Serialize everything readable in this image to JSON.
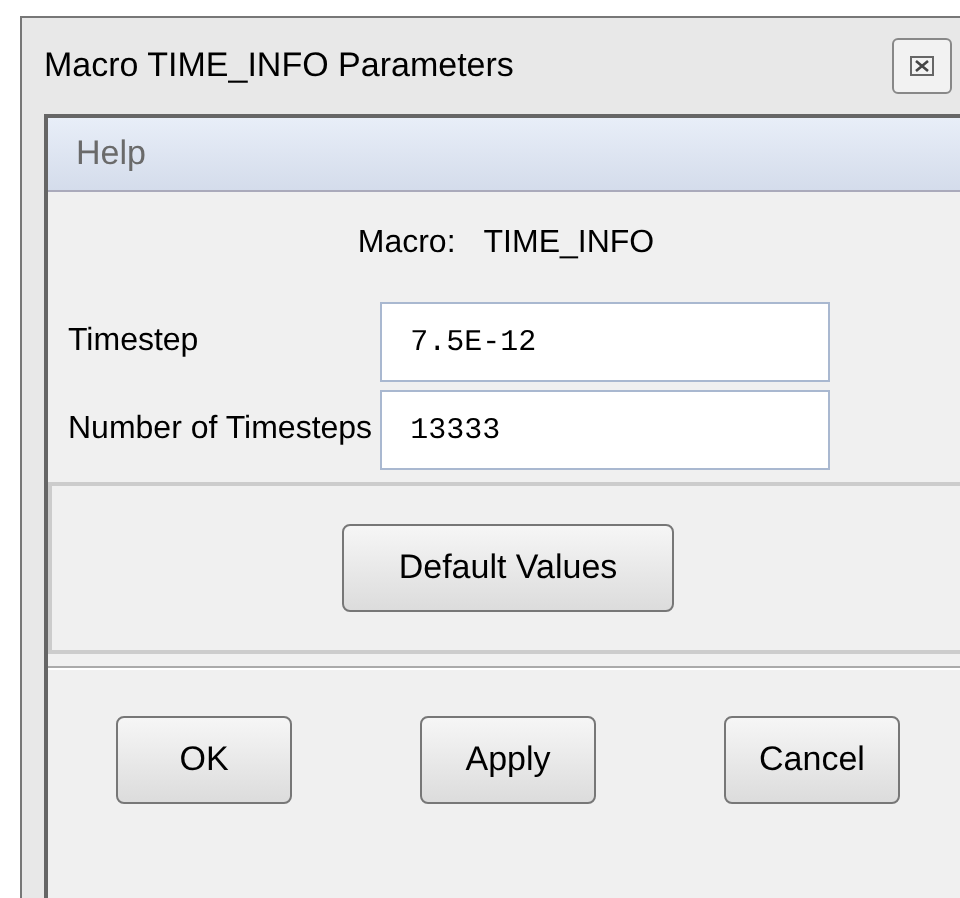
{
  "window": {
    "title": "Macro TIME_INFO Parameters"
  },
  "menu": [
    {
      "label": "Help"
    }
  ],
  "macro": {
    "label": "Macro:",
    "value": "TIME_INFO"
  },
  "fields": [
    {
      "label": "Timestep",
      "value": "7.5E-12"
    },
    {
      "label": "Number of Timesteps",
      "value": "13333"
    }
  ],
  "group_button": "Default Values",
  "buttons": [
    "OK",
    "Apply",
    "Cancel"
  ]
}
